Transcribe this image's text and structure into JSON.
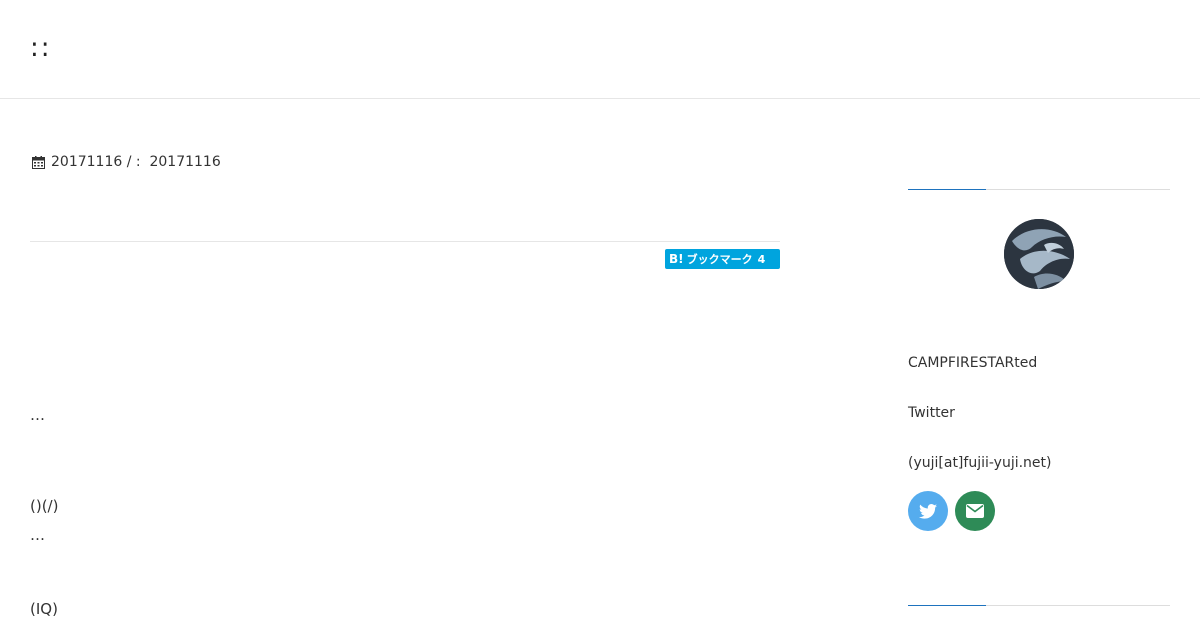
{
  "header": {
    "site_title": "::"
  },
  "post": {
    "meta": "20171116 / :  20171116",
    "hatena": {
      "label": "ブックマーク",
      "count": "4"
    },
    "lines": [
      "…",
      "()(/)",
      "…",
      "(IQ)"
    ]
  },
  "sidebar": {
    "profile_name": "CAMPFIRESTARted",
    "twitter_label": "Twitter",
    "email_text": "(yuji[at]fujii-yuji.net)"
  },
  "colors": {
    "hatena_blue": "#00a4de",
    "twitter_blue": "#55acee",
    "mail_green": "#2e8b57",
    "accent_blue": "#1e73be"
  },
  "icons": [
    "calendar-icon",
    "hatena-bookmark-icon",
    "twitter-icon",
    "envelope-icon"
  ]
}
